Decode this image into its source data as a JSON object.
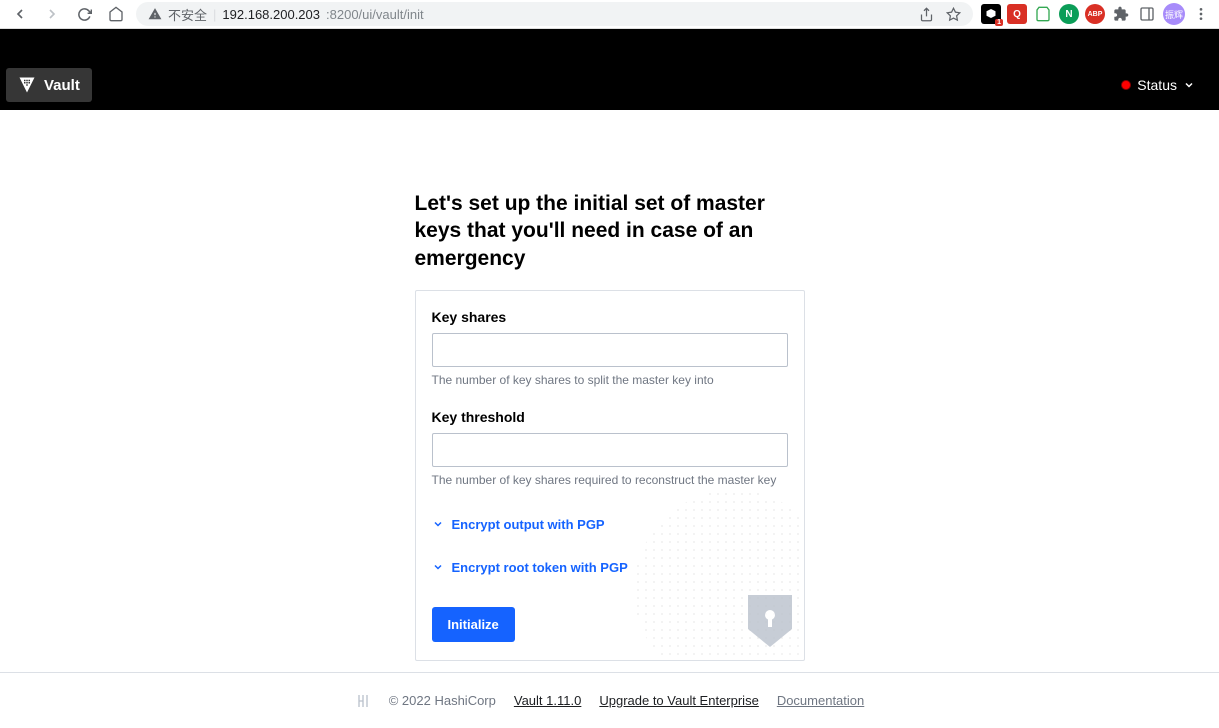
{
  "browser": {
    "security_text": "不安全",
    "url_host": "192.168.200.203",
    "url_rest": ":8200/ui/vault/init",
    "ext_badge": "1"
  },
  "header": {
    "brand": "Vault",
    "status": "Status"
  },
  "main": {
    "title": "Let's set up the initial set of master keys that you'll need in case of an emergency",
    "fields": {
      "key_shares": {
        "label": "Key shares",
        "help": "The number of key shares to split the master key into"
      },
      "key_threshold": {
        "label": "Key threshold",
        "help": "The number of key shares required to reconstruct the master key"
      }
    },
    "toggles": {
      "pgp_output": "Encrypt output with PGP",
      "pgp_root": "Encrypt root token with PGP"
    },
    "submit": "Initialize"
  },
  "footer": {
    "copyright": "© 2022 HashiCorp",
    "version": "Vault 1.11.0",
    "upgrade": "Upgrade to Vault Enterprise",
    "docs": "Documentation"
  }
}
